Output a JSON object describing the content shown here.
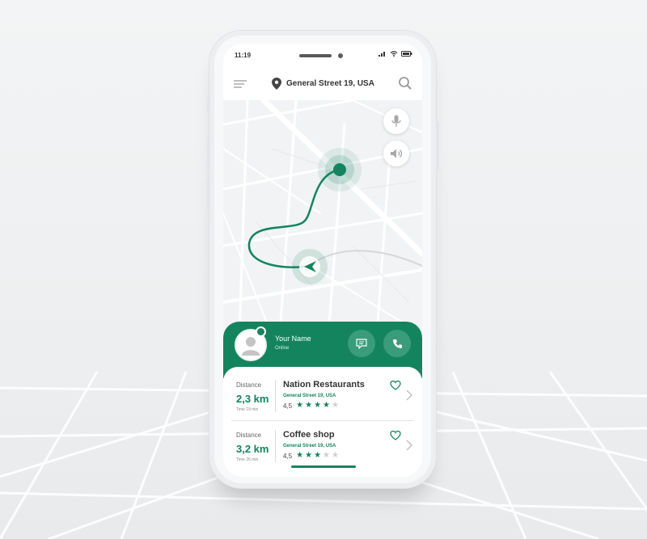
{
  "colors": {
    "accent": "#14845f",
    "accent_light": "#3a9c7a",
    "star_on": "#14845f",
    "star_off": "#cfcfcf",
    "map_bg": "#f2f3f4",
    "road": "#ffffff"
  },
  "status_bar": {
    "time": "11:19",
    "icons": [
      "signal-icon",
      "wifi-icon",
      "battery-icon"
    ]
  },
  "header": {
    "menu_icon": "menu-icon",
    "location_icon": "location-pin-icon",
    "location": "General Street 19, USA",
    "search_icon": "search-icon"
  },
  "map": {
    "mic_icon": "microphone-icon",
    "speaker_icon": "speaker-icon",
    "destination_icon": "destination-marker-icon",
    "current_icon": "navigation-arrow-icon"
  },
  "driver": {
    "name": "Your Name",
    "status": "Online",
    "message_icon": "message-icon",
    "call_icon": "phone-icon"
  },
  "places": [
    {
      "distance_label": "Distance",
      "distance": "2,3 km",
      "time": "Time 19 min",
      "name": "Nation Restaurants",
      "address": "General Street 19, USA",
      "rating": 4,
      "rating_text": "4,5"
    },
    {
      "distance_label": "Distance",
      "distance": "3,2 km",
      "time": "Time 26 min",
      "name": "Coffee shop",
      "address": "General Street 19, USA",
      "rating": 3,
      "rating_text": "4,5"
    }
  ]
}
